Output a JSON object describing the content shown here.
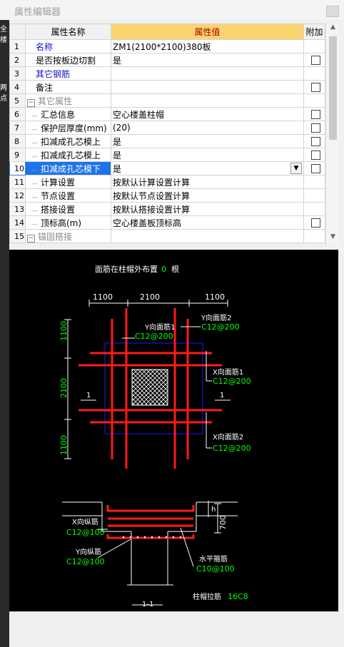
{
  "window": {
    "title": "属性编辑器"
  },
  "left_edge_labels": [
    "全楼",
    "两点"
  ],
  "grid": {
    "headers": {
      "num": "",
      "name": "属性名称",
      "value": "属性值",
      "extra": "附加"
    },
    "rows": [
      {
        "num": "1",
        "name": "名称",
        "value": "ZM1(2100*2100)380板",
        "style": "blue",
        "checkbox": false
      },
      {
        "num": "2",
        "name": "是否按板边切割",
        "value": "是",
        "style": "normal",
        "checkbox": true
      },
      {
        "num": "3",
        "name": "其它钢筋",
        "value": "",
        "style": "blue",
        "checkbox": false
      },
      {
        "num": "4",
        "name": "备注",
        "value": "",
        "style": "normal",
        "checkbox": true
      },
      {
        "num": "5",
        "name": "其它属性",
        "value": "",
        "style": "group",
        "checkbox": false
      },
      {
        "num": "6",
        "name": "汇总信息",
        "value": "空心楼盖柱帽",
        "style": "child",
        "checkbox": true
      },
      {
        "num": "7",
        "name": "保护层厚度(mm)",
        "value": "(20)",
        "style": "child",
        "checkbox": true
      },
      {
        "num": "8",
        "name": "扣减成孔芯模上",
        "value": "是",
        "style": "child",
        "checkbox": true
      },
      {
        "num": "9",
        "name": "扣减成孔芯模上",
        "value": "是",
        "style": "child",
        "checkbox": true
      },
      {
        "num": "10",
        "name": "扣减成孔芯模下",
        "value": "是",
        "style": "selected",
        "checkbox": true
      },
      {
        "num": "11",
        "name": "计算设置",
        "value": "按默认计算设置计算",
        "style": "child",
        "checkbox": false
      },
      {
        "num": "12",
        "name": "节点设置",
        "value": "按默认节点设置计算",
        "style": "child",
        "checkbox": false
      },
      {
        "num": "13",
        "name": "搭接设置",
        "value": "按默认搭接设置计算",
        "style": "child",
        "checkbox": false
      },
      {
        "num": "14",
        "name": "顶标高(m)",
        "value": "空心楼盖板顶标高",
        "style": "child",
        "checkbox": true
      },
      {
        "num": "15",
        "name": "锚固搭接",
        "value": "",
        "style": "group",
        "checkbox": false
      }
    ]
  },
  "cad": {
    "top_note": {
      "label": "面筋在柱帽外布置",
      "value": "0",
      "unit": "根"
    },
    "dims_top": [
      "1100",
      "2100",
      "1100"
    ],
    "dims_left": [
      "1100",
      "2100",
      "1100"
    ],
    "section_marks": [
      "1",
      "1"
    ],
    "y_face1": {
      "label": "Y向面筋1",
      "value": "C12@200"
    },
    "y_face2": {
      "label": "Y向面筋2",
      "value": "C12@200"
    },
    "x_face1": {
      "label": "X向面筋1",
      "value": "C12@200"
    },
    "x_face2": {
      "label": "X向面筋2",
      "value": "C12@200"
    },
    "h_mark": "h",
    "dim_700": "700",
    "x_long": {
      "label": "X向纵筋",
      "value": "C12@100"
    },
    "y_long": {
      "label": "Y向纵筋",
      "value": "C12@100"
    },
    "h_stirrup": {
      "label": "水平箍筋",
      "value": "C10@100"
    },
    "cap_tie": {
      "label": "柱帽拉筋",
      "value": "16C8"
    },
    "section_title": "1-1"
  },
  "colors": {
    "rebar": "#ff1a1a",
    "dim_text": "#00ff00",
    "label_text": "#ffffff",
    "cap_outline": "#1a1aff",
    "selection": "#1e73e8"
  }
}
